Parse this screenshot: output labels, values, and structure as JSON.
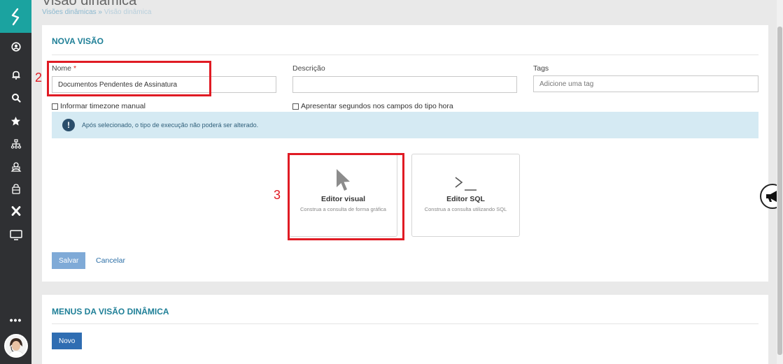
{
  "header": {
    "title": "Visão dinâmica",
    "breadcrumb": {
      "parent": "Visões dinâmicas",
      "separator": "»",
      "current": "Visão dinâmica"
    }
  },
  "sidebar": {
    "icons": [
      "user-circle-icon",
      "bell-icon",
      "search-icon",
      "star-icon",
      "sitemap-icon",
      "users-icon",
      "bag-icon",
      "x-icon",
      "monitor-icon"
    ],
    "more_label": "•••"
  },
  "nova_visao": {
    "title": "NOVA VISÃO",
    "nome_label": "Nome",
    "required_mark": "*",
    "nome_value": "Documentos Pendentes de Assinatura",
    "descricao_label": "Descrição",
    "descricao_value": "",
    "tags_label": "Tags",
    "tags_placeholder": "Adicione uma tag",
    "timezone_label": "Informar timezone manual",
    "segundos_label": "Apresentar segundos nos campos do tipo hora",
    "info_text": "Após selecionado, o tipo de execução não poderá ser alterado.",
    "options": [
      {
        "title": "Editor visual",
        "desc": "Construa a consulta de forma gráfica",
        "icon": "cursor-arrow-icon"
      },
      {
        "title": "Editor SQL",
        "desc": "Construa a consulta utilizando SQL",
        "icon": "terminal-icon"
      }
    ],
    "save_label": "Salvar",
    "cancel_label": "Cancelar"
  },
  "menus": {
    "title": "MENUS DA VISÃO DINÂMICA",
    "new_label": "Novo"
  },
  "annotations": {
    "nome_step": "2",
    "editor_step": "3"
  },
  "colors": {
    "accent": "#1ba3a0",
    "sidebar": "#2f3033",
    "title": "#1e7f97",
    "annotation": "#e01b24",
    "primary_button": "#2f6db2"
  }
}
